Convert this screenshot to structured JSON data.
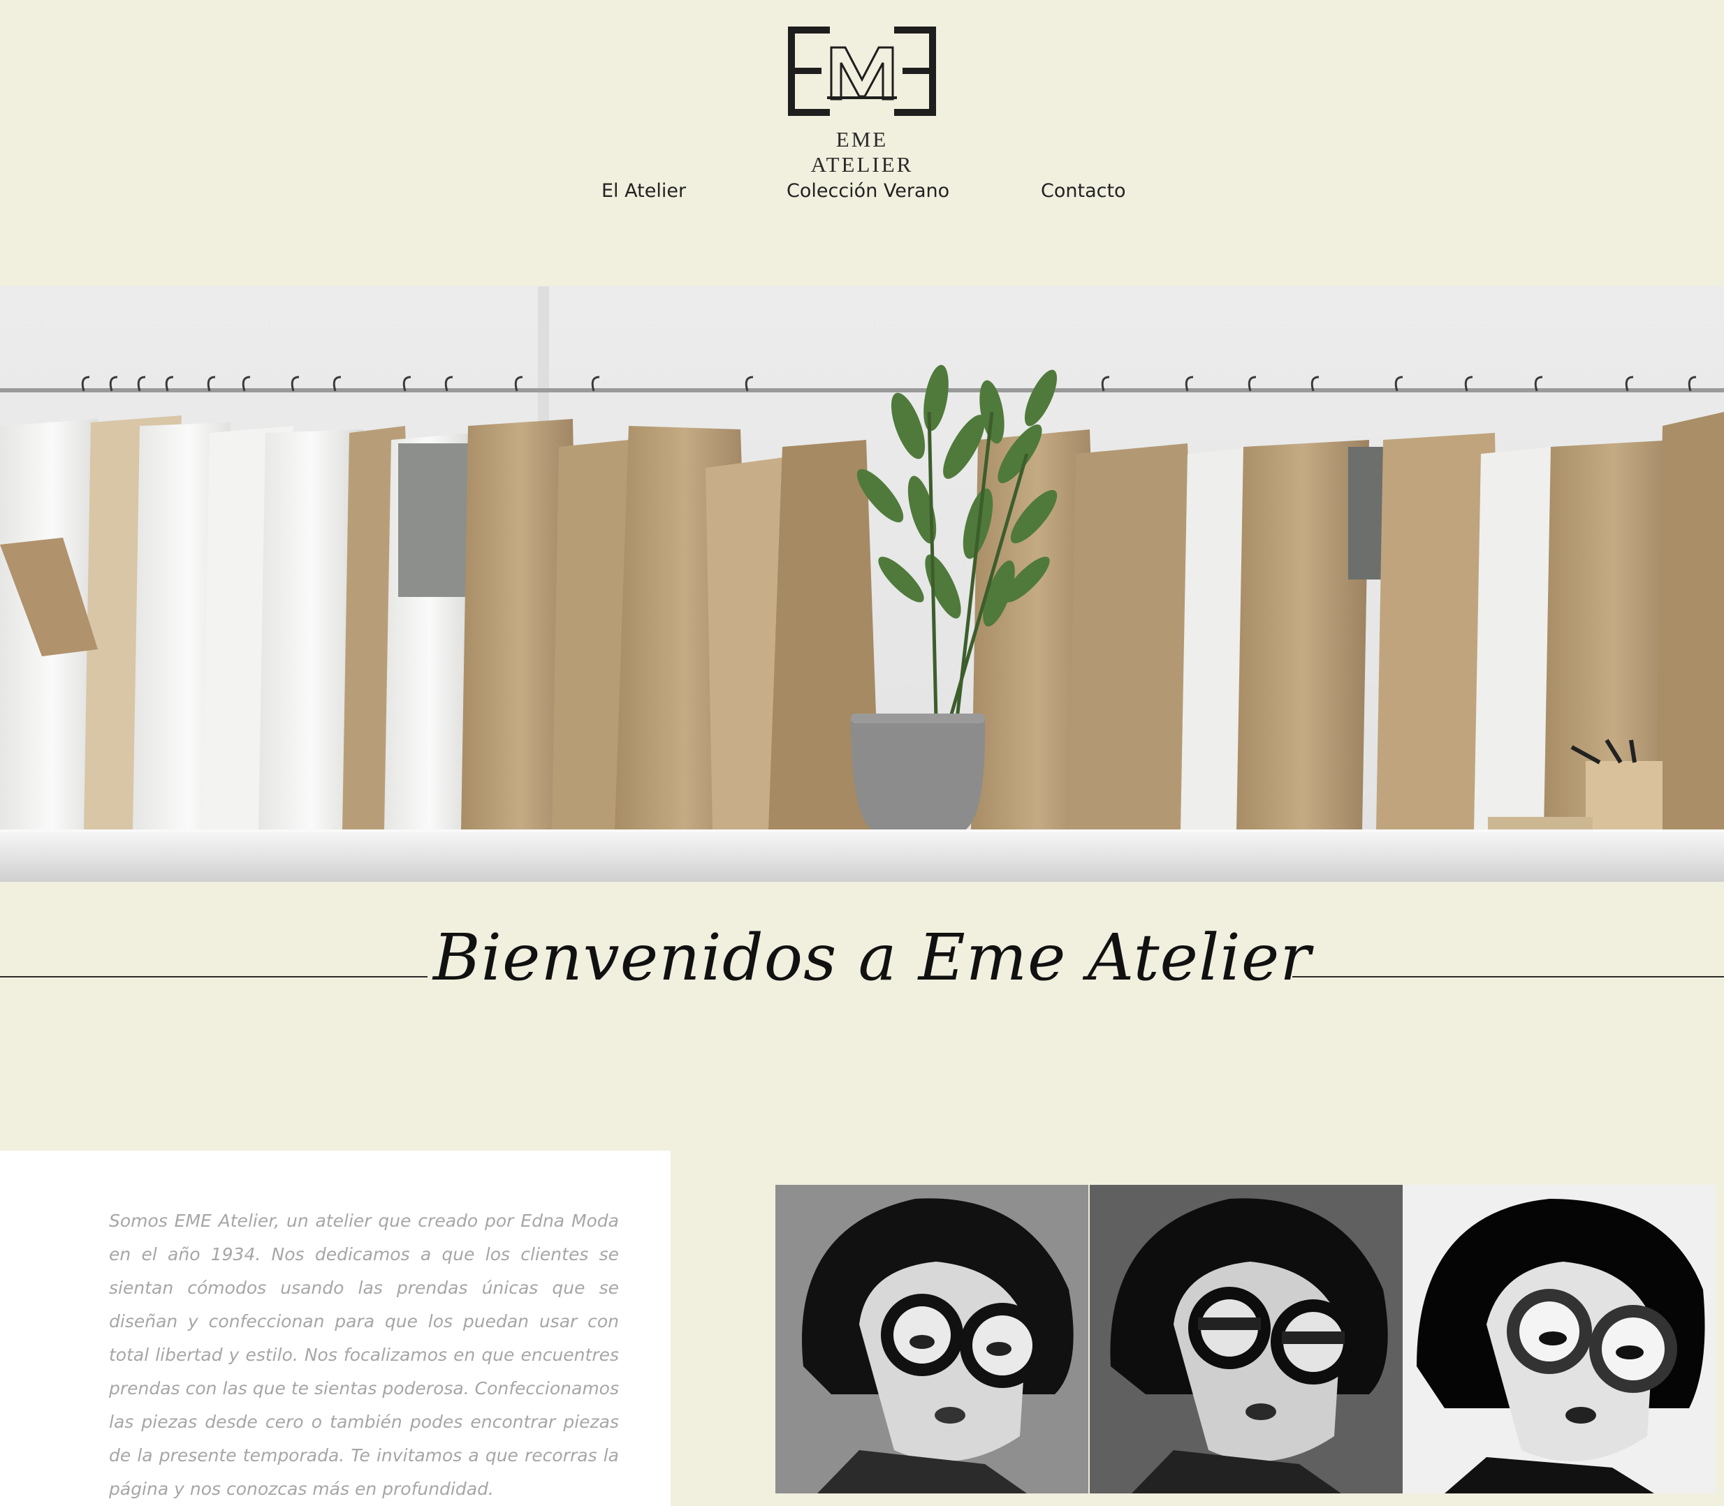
{
  "header": {
    "logo_text": "EME ATELIER",
    "logo_monogram": "EME"
  },
  "nav": {
    "items": [
      {
        "label": "El Atelier"
      },
      {
        "label": "Colección Verano"
      },
      {
        "label": "Contacto"
      }
    ]
  },
  "hero": {
    "image": "atelier-workshop-photo"
  },
  "welcome": {
    "title": "Bienvenidos a Eme Atelier"
  },
  "about": {
    "text": "Somos EME Atelier, un atelier que creado por Edna Moda en el año 1934. Nos dedicamos a que los clientes se sientan cómodos usando las prendas únicas que se diseñan y confeccionan para que los puedan usar con total libertad y estilo. Nos focalizamos en que encuentres prendas con las que te sientas poderosa. Confeccionamos las piezas desde cero o también podes encontrar piezas de la presente temporada. Te invitamos a que recorras la página y nos conozcas más en profundidad."
  },
  "gallery": {
    "images": [
      "edna-portrait-1",
      "edna-portrait-2",
      "edna-portrait-3"
    ]
  },
  "colors": {
    "background": "#f1efde",
    "text_dark": "#222222",
    "text_muted": "#a6a6a6",
    "paper_brown": "#b49a72"
  }
}
